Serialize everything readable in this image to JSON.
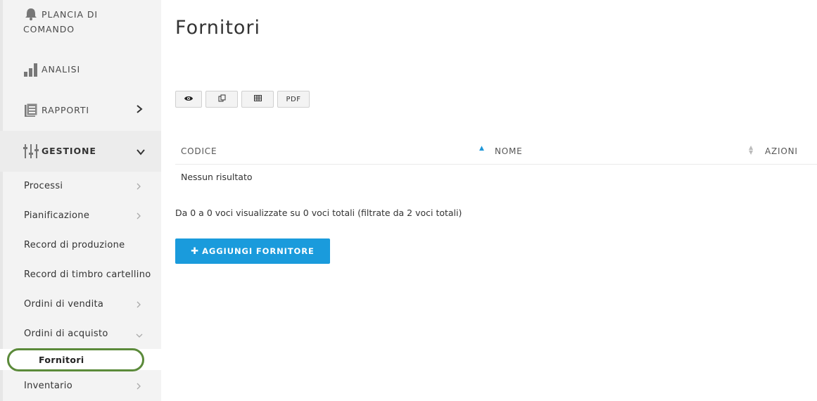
{
  "sidebar": {
    "main_items": [
      {
        "label_line1": "PLANCIA DI",
        "label_line2": "COMANDO",
        "icon": "bell-icon"
      },
      {
        "label": "ANALISI",
        "icon": "bar-chart-icon"
      },
      {
        "label": "RAPPORTI",
        "icon": "report-icon"
      },
      {
        "label": "GESTIONE",
        "icon": "sliders-icon"
      }
    ],
    "sub_items": [
      {
        "label": "Processi"
      },
      {
        "label": "Pianificazione"
      },
      {
        "label": "Record di produzione"
      },
      {
        "label": "Record di timbro cartellino"
      },
      {
        "label": "Ordini di vendita"
      },
      {
        "label": "Ordini di acquisto"
      },
      {
        "label": "Fornitori"
      },
      {
        "label": "Inventario"
      }
    ]
  },
  "main": {
    "title": "Fornitori",
    "toolbar": {
      "pdf_label": "PDF"
    },
    "table": {
      "columns": [
        "CODICE",
        "NOME",
        "AZIONI"
      ],
      "empty_message": "Nessun risultato"
    },
    "info_text": "Da 0 a 0 voci visualizzate su 0 voci totali (filtrate da  2  voci totali)",
    "add_button_label": "AGGIUNGI FORNITORE"
  },
  "colors": {
    "accent": "#1a9bdc",
    "highlight_ring": "#5b8a3a",
    "sidebar_bg": "#f3f3f3"
  }
}
